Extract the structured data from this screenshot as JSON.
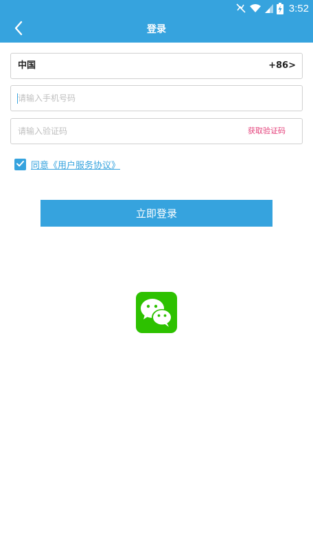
{
  "status_bar": {
    "time": "3:52",
    "icons": [
      "mute-icon",
      "wifi-icon",
      "signal-icon",
      "battery-charging-icon"
    ]
  },
  "header": {
    "title": "登录",
    "back_icon": "chevron-left-icon"
  },
  "form": {
    "country": {
      "name": "中国",
      "code": "+86>"
    },
    "phone": {
      "value": "",
      "placeholder": "请输入手机号码"
    },
    "verification_code": {
      "value": "",
      "placeholder": "请输入验证码",
      "get_code_label": "获取验证码"
    },
    "agreement": {
      "checked": true,
      "label": "同意《用户服务协议》"
    },
    "login_label": "立即登录"
  },
  "social": {
    "wechat_icon": "wechat-icon"
  },
  "colors": {
    "accent": "#36a3de",
    "get_code": "#e4407a",
    "wechat": "#2dc100",
    "border": "#d0d0d0",
    "placeholder": "#bfbfbf"
  }
}
